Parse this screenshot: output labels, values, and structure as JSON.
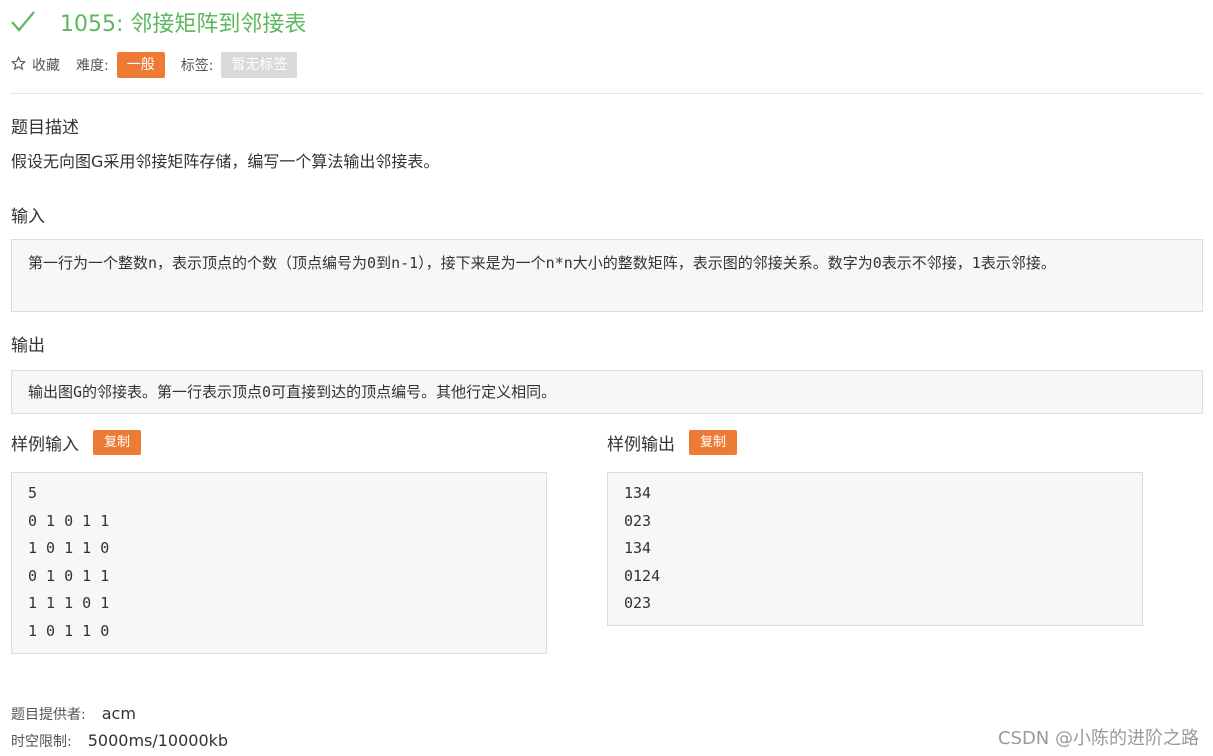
{
  "header": {
    "title": "1055: 邻接矩阵到邻接表",
    "favorite_label": "收藏",
    "difficulty_label": "难度:",
    "difficulty_value": "一般",
    "tags_label": "标签:",
    "tags_value": "暂无标签",
    "colors": {
      "solved": "#5cb85c",
      "difficulty": "#ee7b35",
      "tag": "#d9d9d9"
    },
    "icons": {
      "status": "check-icon",
      "favorite": "star-icon"
    }
  },
  "description": {
    "heading": "题目描述",
    "text": "假设无向图G采用邻接矩阵存储，编写一个算法输出邻接表。"
  },
  "input": {
    "heading": "输入",
    "text": "第一行为一个整数n，表示顶点的个数（顶点编号为0到n-1），接下来是为一个n*n大小的整数矩阵，表示图的邻接关系。数字为0表示不邻接，1表示邻接。"
  },
  "output": {
    "heading": "输出",
    "text": "输出图G的邻接表。第一行表示顶点0可直接到达的顶点编号。其他行定义相同。"
  },
  "sample_input": {
    "heading": "样例输入",
    "copy_label": "复制",
    "lines": [
      "5",
      "0 1 0 1 1",
      "1 0 1 1 0",
      "0 1 0 1 1",
      "1 1 1 0 1",
      "1 0 1 1 0"
    ]
  },
  "sample_output": {
    "heading": "样例输出",
    "copy_label": "复制",
    "lines": [
      "134",
      "023",
      "134",
      "0124",
      "023"
    ]
  },
  "footer": {
    "provider_label": "题目提供者:",
    "provider_value": "acm",
    "limit_label": "时空限制:",
    "limit_value": "5000ms/10000kb"
  },
  "watermark": "CSDN @小陈的进阶之路"
}
